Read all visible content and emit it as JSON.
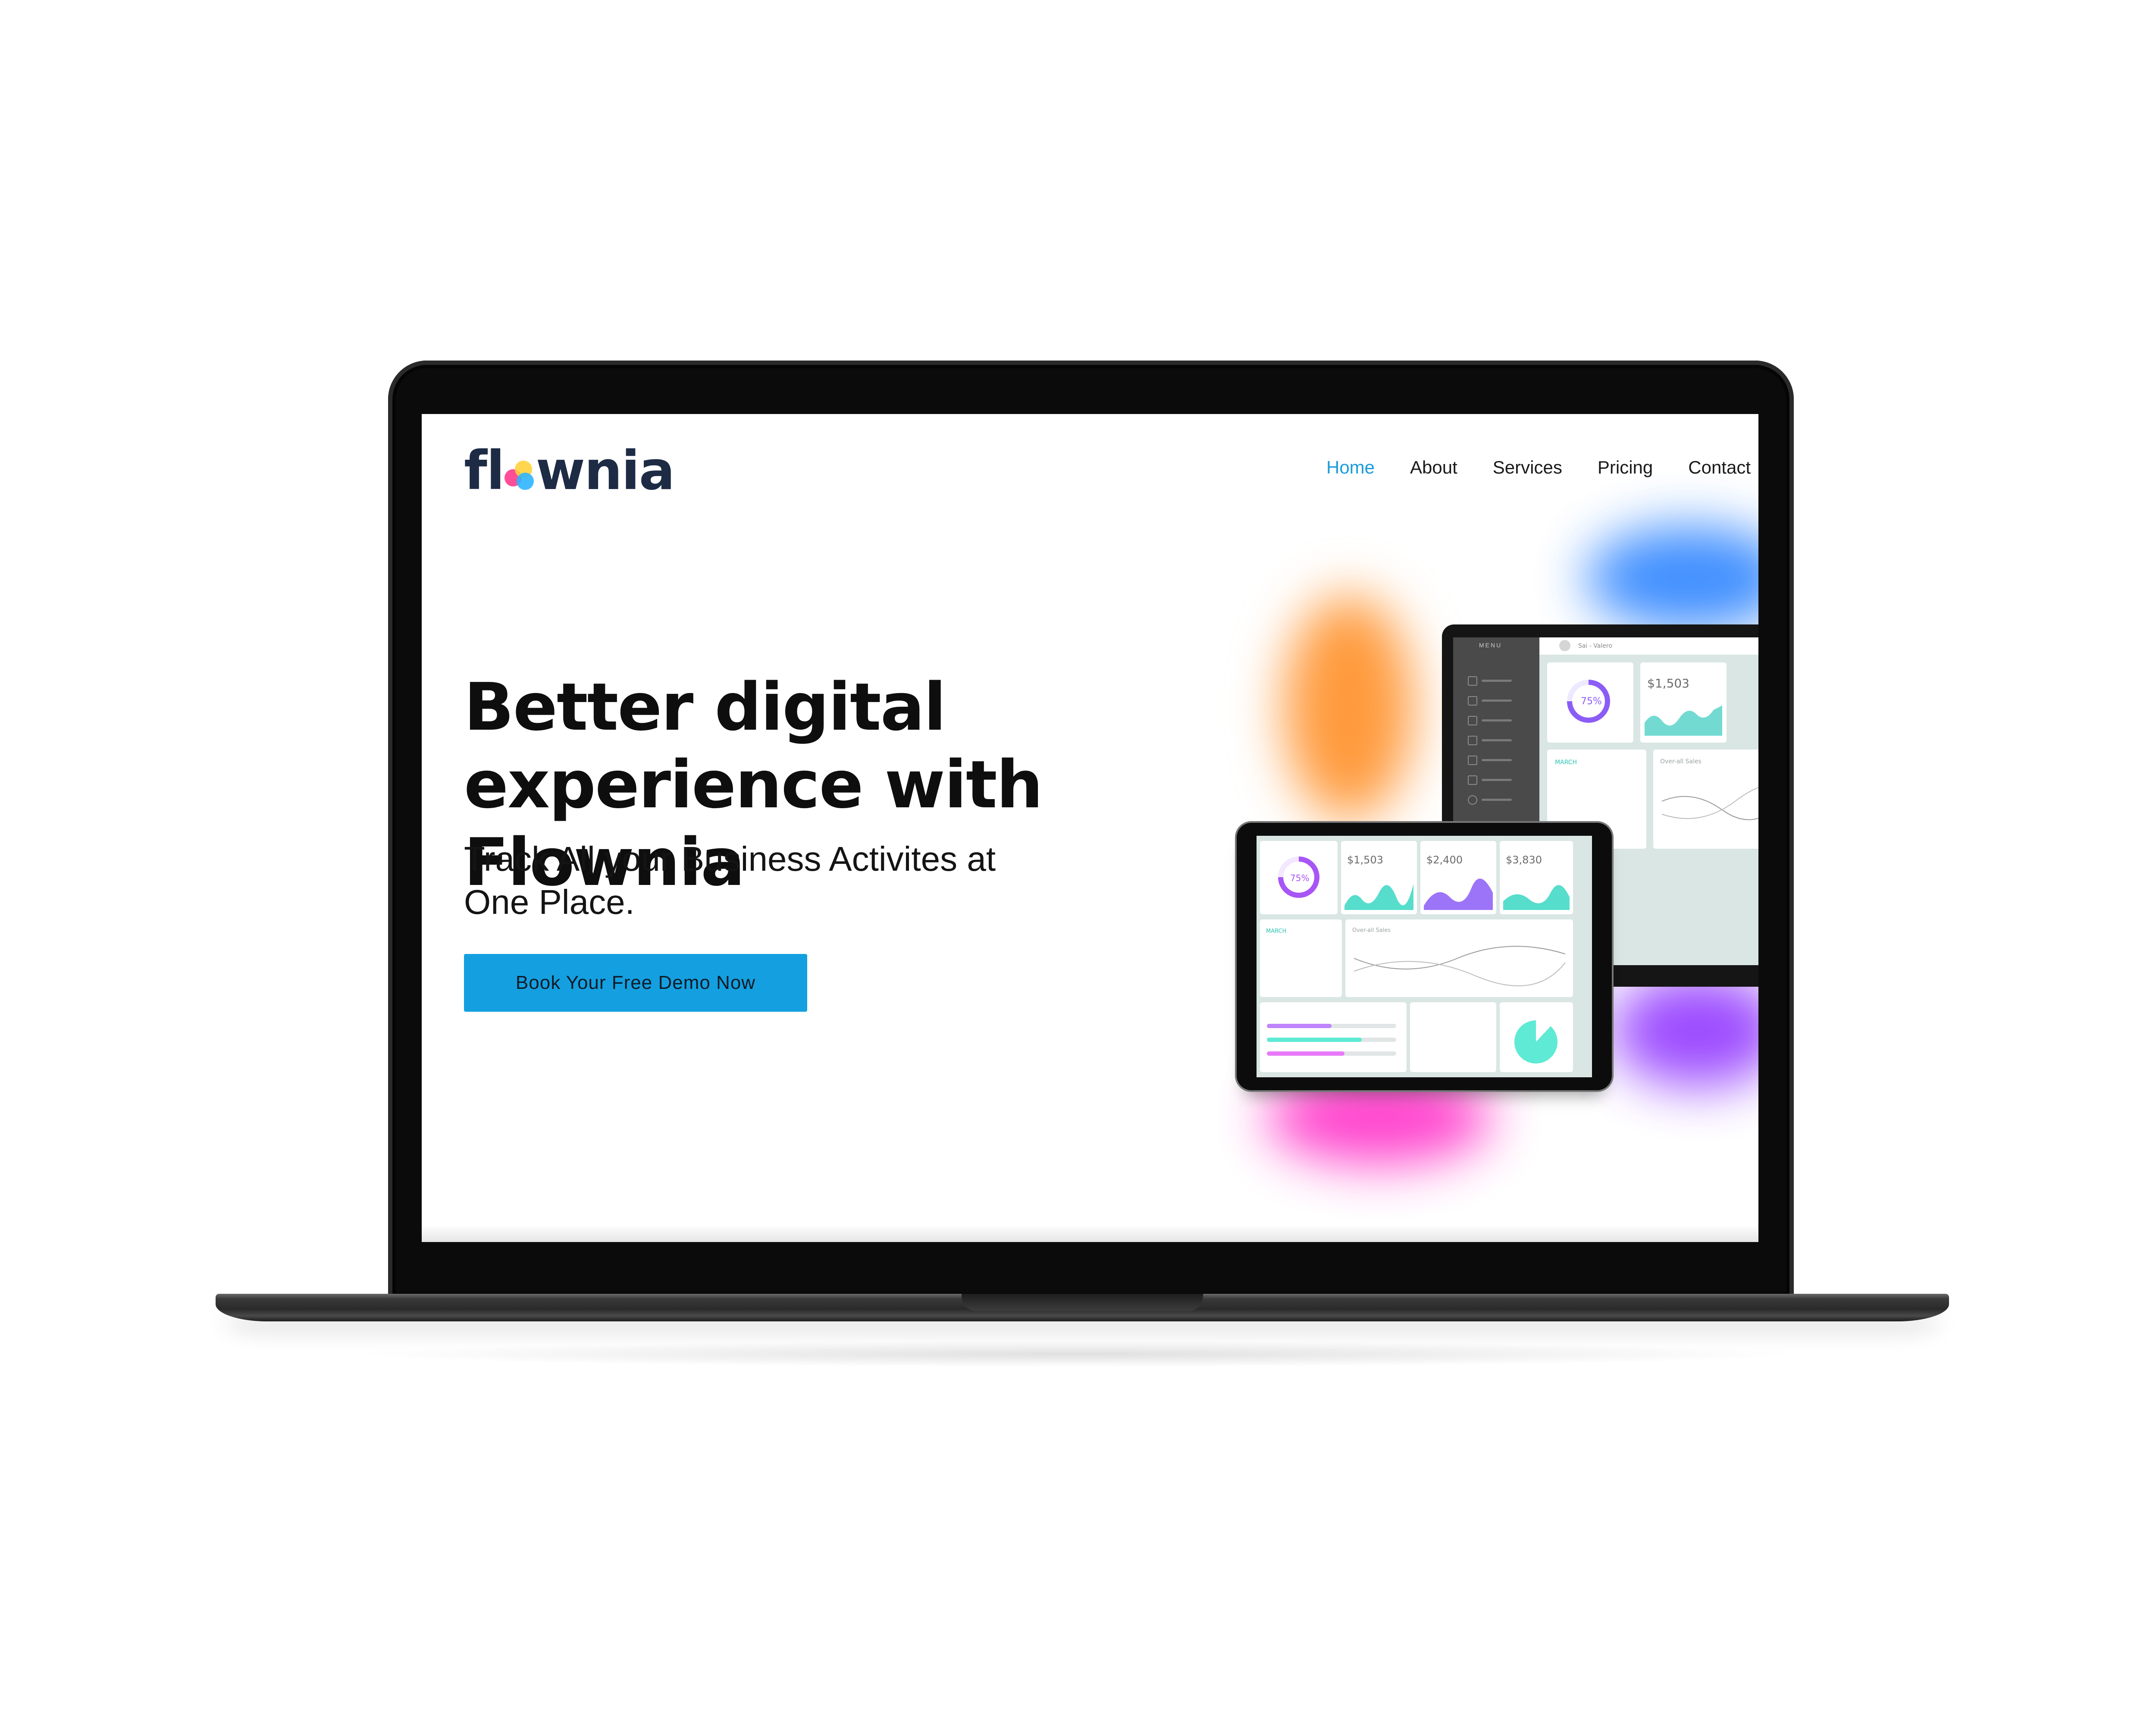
{
  "site": {
    "logo_text": "flownia",
    "nav": [
      {
        "label": "Home",
        "active": true
      },
      {
        "label": "About",
        "active": false
      },
      {
        "label": "Services",
        "active": false
      },
      {
        "label": "Pricing",
        "active": false
      },
      {
        "label": "Contact",
        "active": false
      }
    ],
    "headline": "Better digital experience with Flownia",
    "subline": "Track All your Business Activites at One Place.",
    "cta_label": "Book Your Free Demo Now"
  },
  "mockup": {
    "laptop": {
      "menu_label": "MENU",
      "user_name": "Sai - Valero",
      "inventory_percent": "75%",
      "gas_sales_value": "$1,503",
      "calendar_month": "MARCH",
      "sales_title": "Over-all Sales"
    },
    "tablet": {
      "inventory_percent": "75%",
      "values": [
        "$1,503",
        "$2,400",
        "$3,830"
      ],
      "calendar_month": "MARCH",
      "sales_title": "Over-all Sales"
    }
  },
  "colors": {
    "accent": "#1a9bdb",
    "cta_bg": "#14a0e0",
    "logo_dark": "#1d2b45",
    "glow_orange": "#ff9a3c",
    "glow_blue": "#1e7bff",
    "glow_purple": "#8b2cff",
    "glow_pink": "#ff2fc8"
  }
}
